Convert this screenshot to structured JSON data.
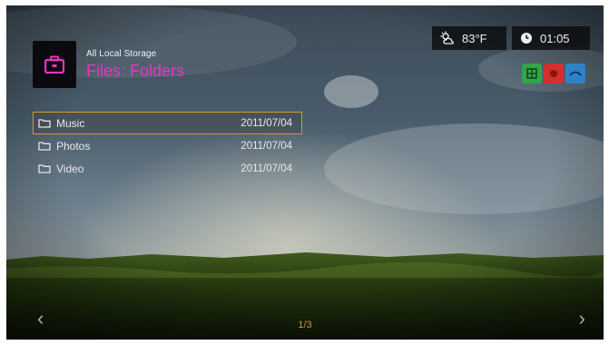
{
  "header": {
    "source": "All Local Storage",
    "title": "Files: Folders"
  },
  "status": {
    "temperature": "83°F",
    "time": "01:05"
  },
  "color_keys": [
    {
      "icon": "grid-icon",
      "color": "#2fa64a"
    },
    {
      "icon": "circle-icon",
      "color": "#d42f2f"
    },
    {
      "icon": "wave-icon",
      "color": "#2f82c9"
    }
  ],
  "files": [
    {
      "name": "Music",
      "date": "2011/07/04",
      "selected": true
    },
    {
      "name": "Photos",
      "date": "2011/07/04",
      "selected": false
    },
    {
      "name": "Video",
      "date": "2011/07/04",
      "selected": false
    }
  ],
  "pager": "1/3",
  "nav": {
    "left": "‹",
    "right": "›"
  },
  "colors": {
    "accent": "#ea35c2",
    "selection": "#d39b2a",
    "pager": "#c49a34"
  }
}
